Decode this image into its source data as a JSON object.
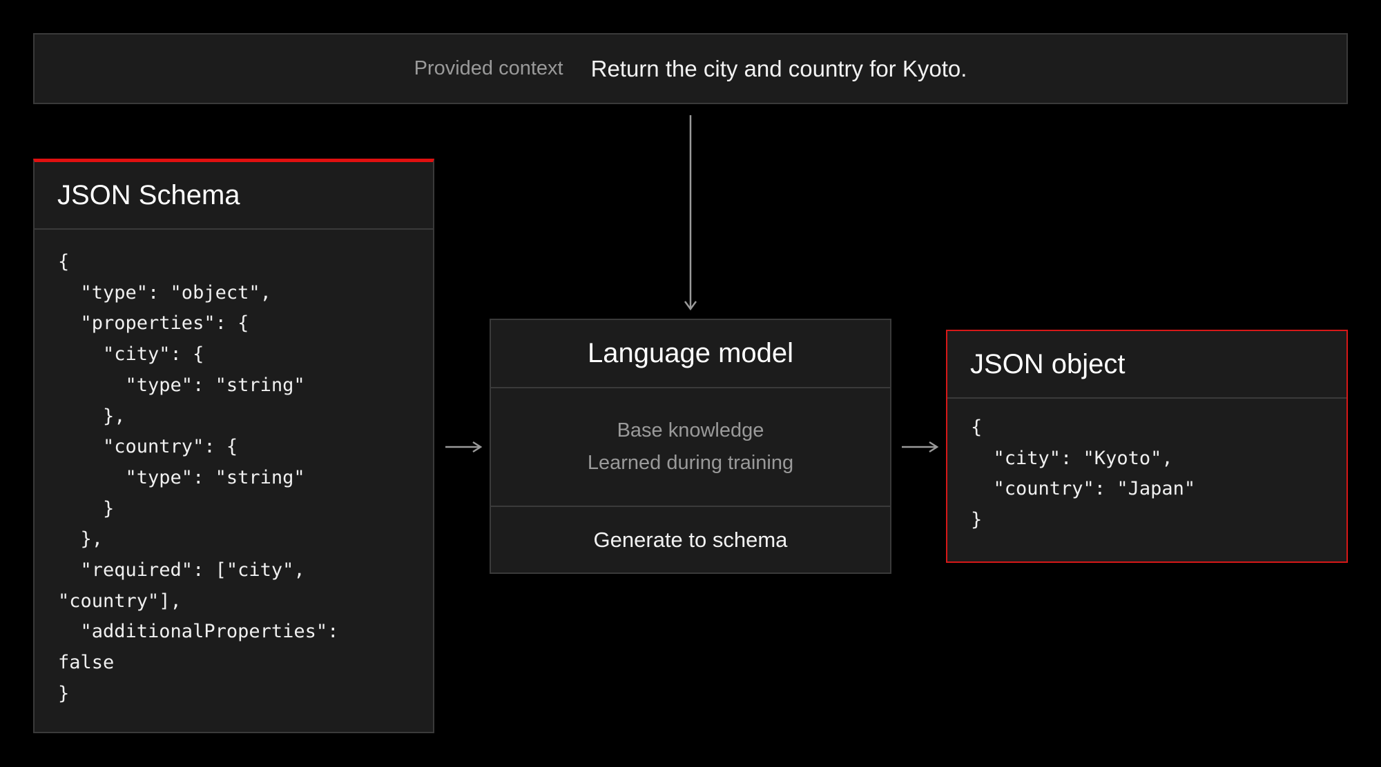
{
  "context": {
    "label": "Provided context",
    "text": "Return the city and country for Kyoto."
  },
  "schema_panel": {
    "title": "JSON Schema",
    "code": "{\n  \"type\": \"object\",\n  \"properties\": {\n    \"city\": {\n      \"type\": \"string\"\n    },\n    \"country\": {\n      \"type\": \"string\"\n    }\n  },\n  \"required\": [\"city\",\n\"country\"],\n  \"additionalProperties\":\nfalse\n}"
  },
  "model_panel": {
    "title": "Language model",
    "knowledge_line1": "Base knowledge",
    "knowledge_line2": "Learned during training",
    "generate": "Generate to schema"
  },
  "output_panel": {
    "title": "JSON object",
    "code": "{\n  \"city\": \"Kyoto\",\n  \"country\": \"Japan\"\n}"
  },
  "colors": {
    "background": "#000000",
    "panel": "#1c1c1c",
    "accent": "#e01010",
    "muted_text": "#9a9a9a"
  }
}
